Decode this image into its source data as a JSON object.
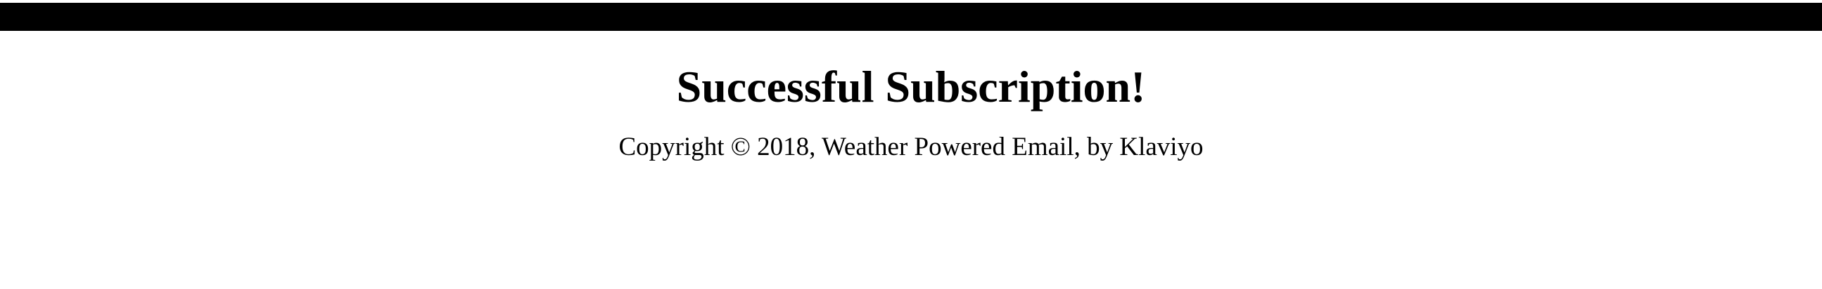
{
  "header": {
    "bar_color": "#000000"
  },
  "main": {
    "title": "Successful Subscription!"
  },
  "footer": {
    "copyright": "Copyright © 2018, Weather Powered Email, by Klaviyo"
  }
}
